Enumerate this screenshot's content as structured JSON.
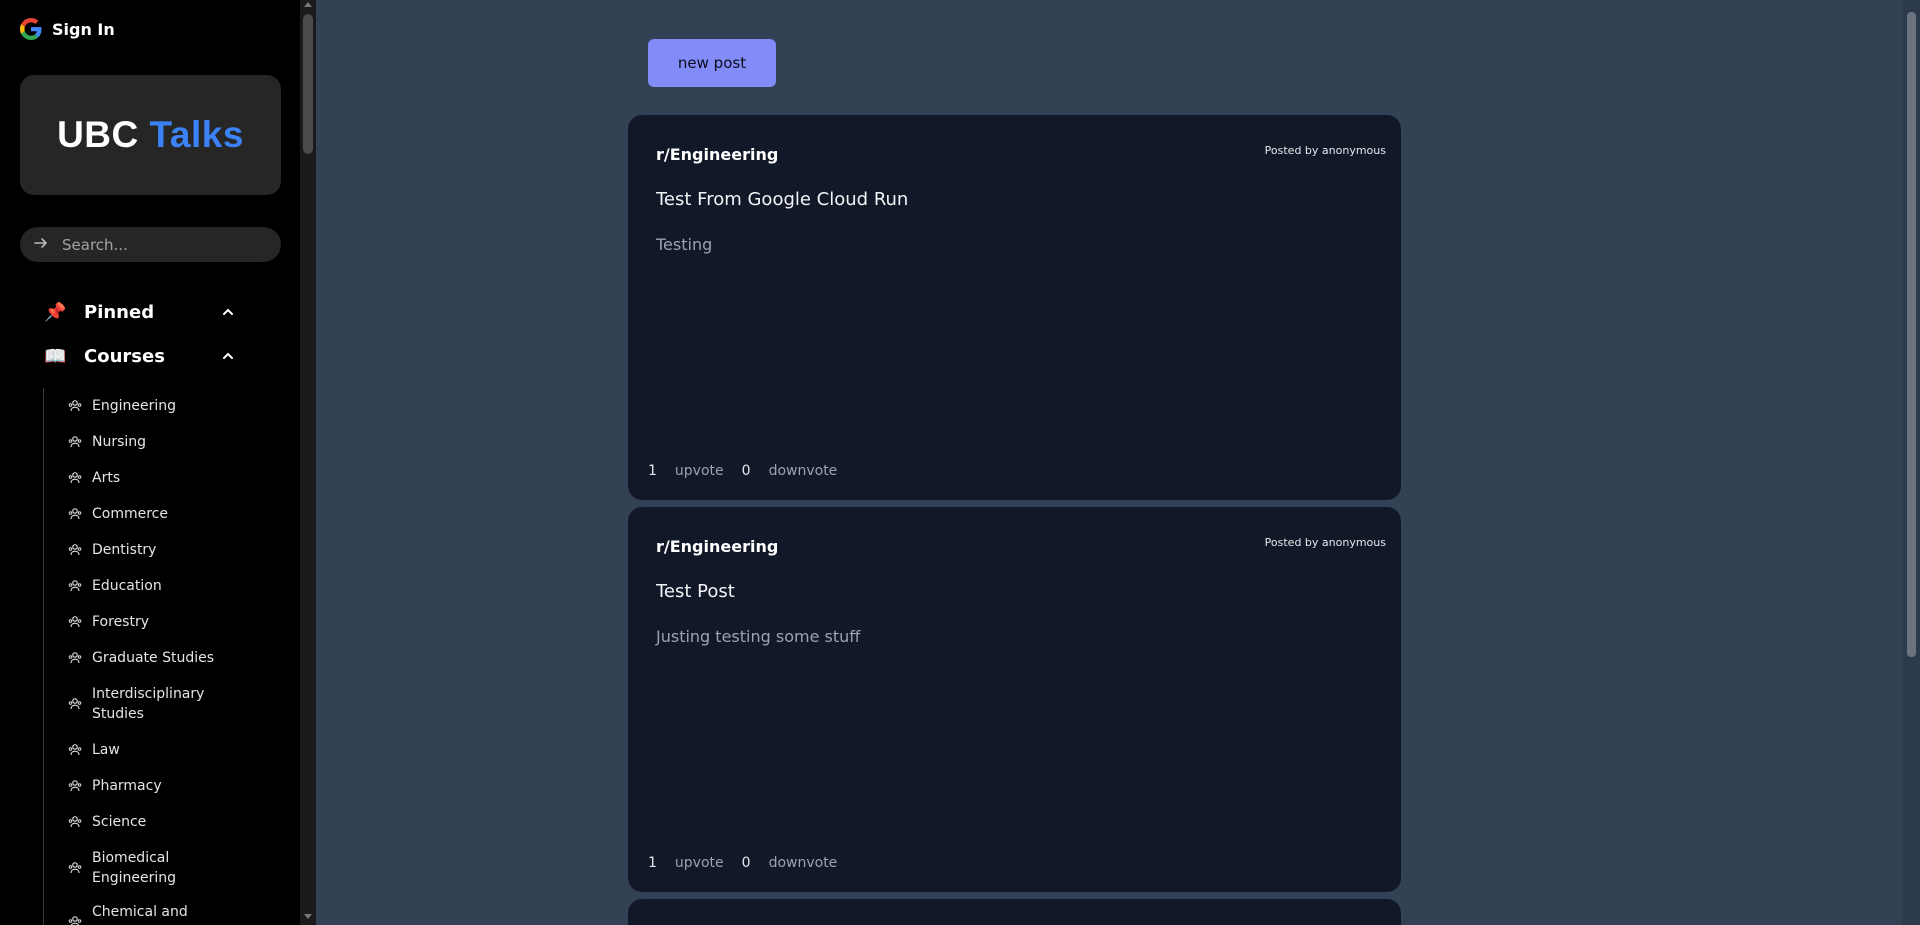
{
  "auth": {
    "sign_in_label": "Sign In",
    "icon": "google-icon"
  },
  "brand": {
    "name_part1": "UBC ",
    "name_part2": "Talks",
    "accent_color": "#3b82f6"
  },
  "search": {
    "placeholder": "Search..."
  },
  "sidebar": {
    "sections": [
      {
        "label": "Pinned",
        "icon": "pin-icon",
        "expanded": true
      },
      {
        "label": "Courses",
        "icon": "book-icon",
        "expanded": true
      }
    ],
    "courses": [
      "Engineering",
      "Nursing",
      "Arts",
      "Commerce",
      "Dentistry",
      "Education",
      "Forestry",
      "Graduate Studies",
      "Interdisciplinary Studies",
      "Law",
      "Pharmacy",
      "Science",
      "Biomedical Engineering",
      "Chemical and Biological"
    ]
  },
  "actions": {
    "new_post_label": "new post",
    "new_post_color": "#818cf8"
  },
  "posts": [
    {
      "subreddit": "r/Engineering",
      "posted_by": "Posted by anonymous",
      "title": "Test From Google Cloud Run",
      "body": "Testing",
      "upvotes": "1",
      "upvote_label": "upvote",
      "downvotes": "0",
      "downvote_label": "downvote"
    },
    {
      "subreddit": "r/Engineering",
      "posted_by": "Posted by anonymous",
      "title": "Test Post",
      "body": "Justing testing some stuff",
      "upvotes": "1",
      "upvote_label": "upvote",
      "downvotes": "0",
      "downvote_label": "downvote"
    }
  ]
}
